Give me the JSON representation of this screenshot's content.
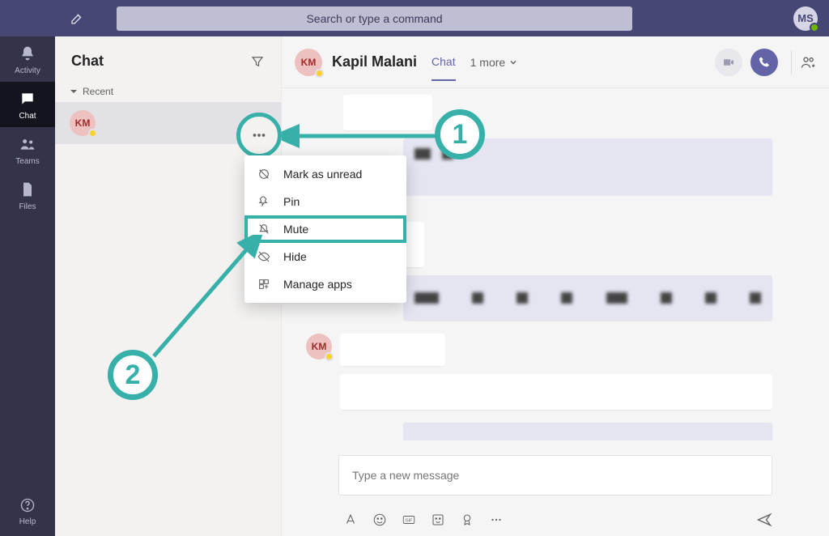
{
  "titlebar": {
    "search_placeholder": "Search or type a command",
    "user_initials": "MS"
  },
  "rail": {
    "activity": "Activity",
    "chat": "Chat",
    "teams": "Teams",
    "files": "Files",
    "help": "Help"
  },
  "chatlist": {
    "title": "Chat",
    "section_recent": "Recent",
    "items": [
      {
        "initials": "KM"
      }
    ]
  },
  "context_menu": {
    "mark_unread": "Mark as unread",
    "pin": "Pin",
    "mute": "Mute",
    "hide": "Hide",
    "manage_apps": "Manage apps"
  },
  "conversation": {
    "avatar_initials": "KM",
    "title": "Kapil Malani",
    "tab_chat": "Chat",
    "participants": "1 more"
  },
  "composer": {
    "placeholder": "Type a new message"
  },
  "annotations": {
    "step1": "1",
    "step2": "2"
  }
}
